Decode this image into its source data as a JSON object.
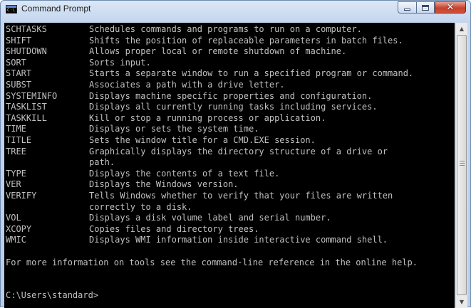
{
  "window": {
    "title": "Command Prompt",
    "icon": "cmd-icon",
    "icon_text": "C:\\",
    "controls": {
      "minimize_icon": "minimize-icon",
      "maximize_icon": "maximize-icon",
      "close_icon": "close-icon",
      "close_glyph": "✕"
    }
  },
  "colors": {
    "console_bg": "#000000",
    "console_text": "#c0c0c0",
    "close_button": "#c6412c"
  },
  "console": {
    "lines": [
      {
        "cmd": "SCHTASKS",
        "desc": "Schedules commands and programs to run on a computer."
      },
      {
        "cmd": "SHIFT",
        "desc": "Shifts the position of replaceable parameters in batch files."
      },
      {
        "cmd": "SHUTDOWN",
        "desc": "Allows proper local or remote shutdown of machine."
      },
      {
        "cmd": "SORT",
        "desc": "Sorts input."
      },
      {
        "cmd": "START",
        "desc": "Starts a separate window to run a specified program or command."
      },
      {
        "cmd": "SUBST",
        "desc": "Associates a path with a drive letter."
      },
      {
        "cmd": "SYSTEMINFO",
        "desc": "Displays machine specific properties and configuration."
      },
      {
        "cmd": "TASKLIST",
        "desc": "Displays all currently running tasks including services."
      },
      {
        "cmd": "TASKKILL",
        "desc": "Kill or stop a running process or application."
      },
      {
        "cmd": "TIME",
        "desc": "Displays or sets the system time."
      },
      {
        "cmd": "TITLE",
        "desc": "Sets the window title for a CMD.EXE session."
      },
      {
        "cmd": "TREE",
        "desc": "Graphically displays the directory structure of a drive or"
      },
      {
        "cmd": "",
        "desc": "path."
      },
      {
        "cmd": "TYPE",
        "desc": "Displays the contents of a text file."
      },
      {
        "cmd": "VER",
        "desc": "Displays the Windows version."
      },
      {
        "cmd": "VERIFY",
        "desc": "Tells Windows whether to verify that your files are written"
      },
      {
        "cmd": "",
        "desc": "correctly to a disk."
      },
      {
        "cmd": "VOL",
        "desc": "Displays a disk volume label and serial number."
      },
      {
        "cmd": "XCOPY",
        "desc": "Copies files and directory trees."
      },
      {
        "cmd": "WMIC",
        "desc": "Displays WMI information inside interactive command shell."
      }
    ],
    "footer": "For more information on tools see the command-line reference in the online help.",
    "prompt": "C:\\Users\\standard>"
  },
  "scrollbar": {
    "up_arrow": "▲",
    "down_arrow": "▼",
    "up_icon": "scroll-up-icon",
    "down_icon": "scroll-down-icon",
    "grip_icon": "grip-icon"
  }
}
